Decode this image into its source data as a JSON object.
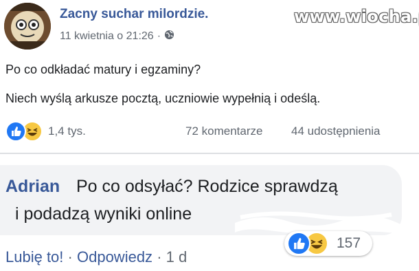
{
  "watermark": "www.wiocha.pl",
  "post": {
    "page_name": "Zacny suchar milordzie.",
    "timestamp": "11 kwietnia o 21:26",
    "separator": "·",
    "privacy_icon": "globe-icon",
    "lines": [
      "Po co odkładać matury i egzaminy?",
      "Niech wyślą arkusze pocztą, uczniowie wypełnią i odeślą."
    ],
    "reactions_count": "1,4 tys.",
    "comments_count": "72 komentarze",
    "shares_count": "44 udostępnienia",
    "reaction_icons": [
      "like-icon",
      "haha-icon"
    ]
  },
  "comment": {
    "author": "Adrian",
    "lines": [
      "Po co odsyłać? Rodzice sprawdzą",
      "i podadzą wyniki online"
    ],
    "like_label": "Lubię to!",
    "dot": "·",
    "reply_label": "Odpowiedz",
    "age": "1 d",
    "reactions_count": "157"
  },
  "colors": {
    "link": "#385898",
    "like_blue": "#2078f4",
    "haha_yellow": "#f7c843",
    "bubble_bg": "#f2f3f5"
  }
}
